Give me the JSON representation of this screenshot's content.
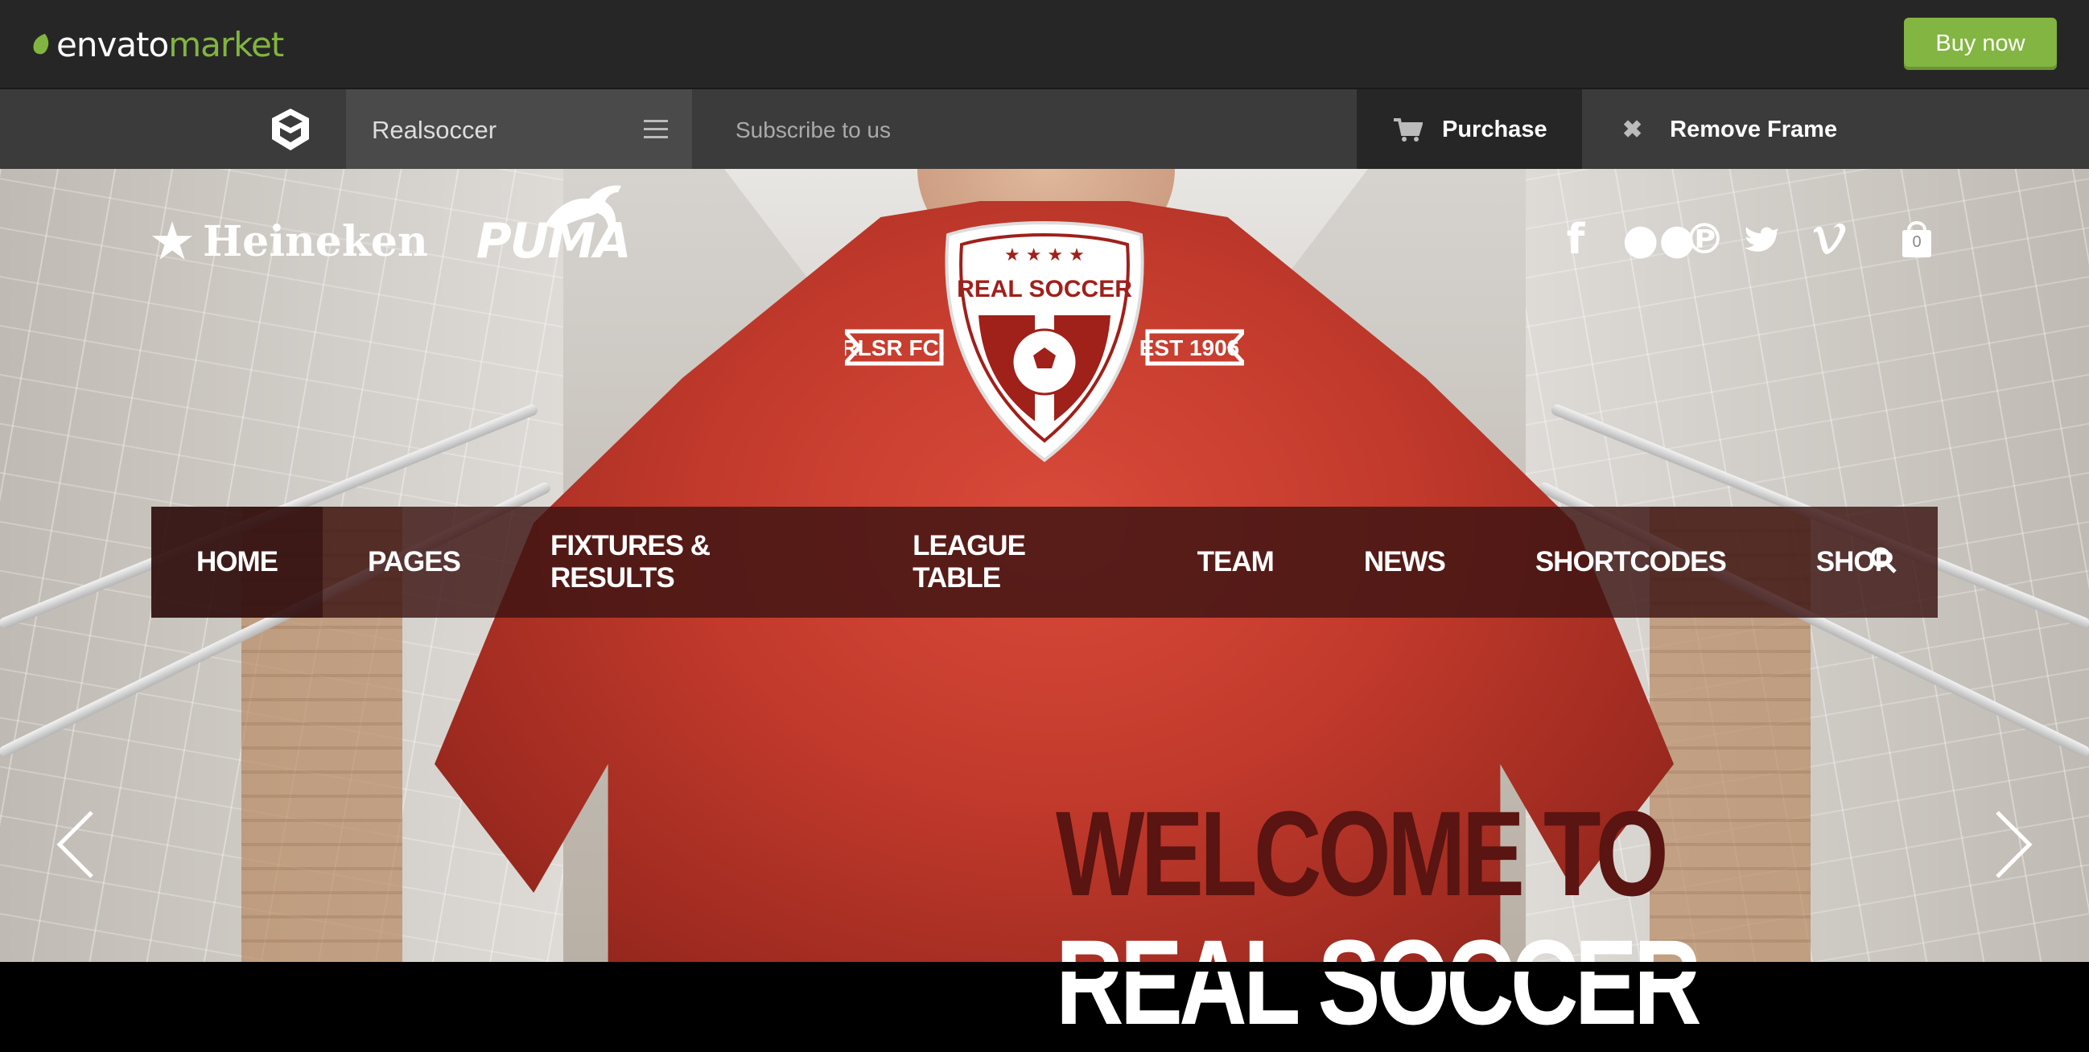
{
  "envato": {
    "brand_prefix": "envato",
    "brand_suffix": "market",
    "buy_now": "Buy now",
    "accent": "#82b541"
  },
  "demo_bar": {
    "theme_name": "Realsoccer",
    "subscribe": "Subscribe to us",
    "purchase": "Purchase",
    "remove_frame": "Remove Frame"
  },
  "site": {
    "sponsors": [
      "Heineken",
      "PUMA"
    ],
    "crest": {
      "title": "REAL SOCCER",
      "left_banner": "RLSR FC.",
      "right_banner": "EST 1906"
    },
    "social_icons": [
      "facebook-icon",
      "flickr-icon",
      "pinterest-icon",
      "twitter-icon",
      "vimeo-icon"
    ],
    "cart_count": "0",
    "nav": [
      "HOME",
      "PAGES",
      "FIXTURES & RESULTS",
      "LEAGUE TABLE",
      "TEAM",
      "NEWS",
      "SHORTCODES",
      "SHOP"
    ],
    "hero_line1": "WELCOME TO",
    "hero_line2": "REAL SOCCER",
    "brand_red": "#a0201a"
  }
}
